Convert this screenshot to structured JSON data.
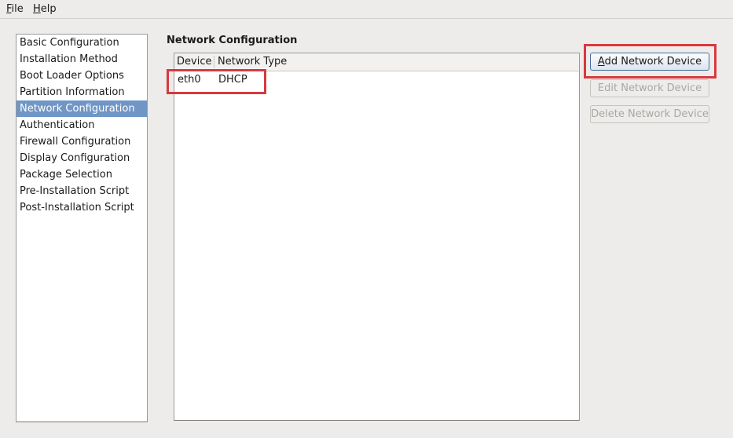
{
  "menubar": {
    "items": [
      {
        "label": "File",
        "mnemonic": "F",
        "rest": "ile"
      },
      {
        "label": "Help",
        "mnemonic": "H",
        "rest": "elp"
      }
    ]
  },
  "sidebar": {
    "selected_index": 4,
    "items": [
      {
        "label": "Basic Configuration"
      },
      {
        "label": "Installation Method"
      },
      {
        "label": "Boot Loader Options"
      },
      {
        "label": "Partition Information"
      },
      {
        "label": "Network Configuration"
      },
      {
        "label": "Authentication"
      },
      {
        "label": "Firewall Configuration"
      },
      {
        "label": "Display Configuration"
      },
      {
        "label": "Package Selection"
      },
      {
        "label": "Pre-Installation Script"
      },
      {
        "label": "Post-Installation Script"
      }
    ]
  },
  "main": {
    "title": "Network Configuration",
    "table": {
      "columns": [
        "Device",
        "Network Type"
      ],
      "rows": [
        [
          "eth0",
          "DHCP"
        ]
      ]
    },
    "buttons": {
      "add": {
        "mnemonic": "A",
        "rest": "dd Network Device",
        "label": "Add Network Device",
        "enabled": true
      },
      "edit": {
        "label": "Edit Network Device",
        "enabled": false
      },
      "delete": {
        "label": "Delete Network Device",
        "enabled": false
      }
    },
    "highlight_color": "#d8393d",
    "selection_color": "#7096c6"
  }
}
